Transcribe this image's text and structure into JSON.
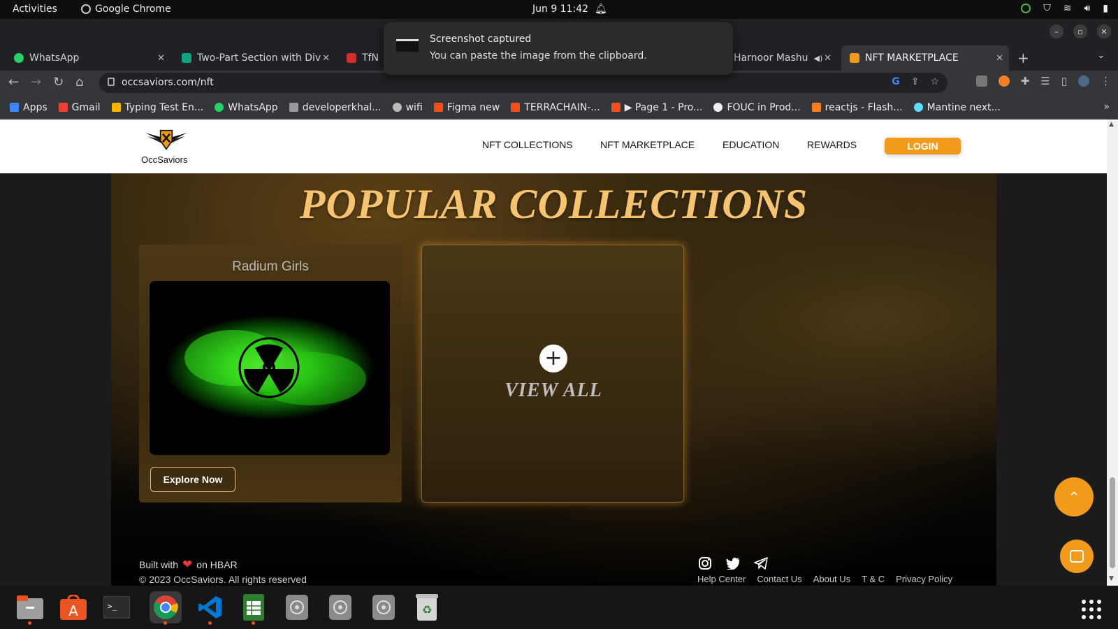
{
  "system": {
    "activities": "Activities",
    "app_name": "Google Chrome",
    "clock": "Jun 9  11:42"
  },
  "tabs": [
    {
      "label": "WhatsApp",
      "color": "#25d366"
    },
    {
      "label": "Two-Part Section with Div",
      "color": "#10a37f"
    },
    {
      "label": "TfN",
      "color": "#d32f2f"
    },
    {
      "label": "Harnoor Mashu",
      "color": "#888888"
    },
    {
      "label": "NFT MARKETPLACE",
      "color": "#f29a1c"
    }
  ],
  "toast": {
    "title": "Screenshot captured",
    "message": "You can paste the image from the clipboard."
  },
  "address_bar": {
    "url": "occsaviors.com/nft"
  },
  "bookmarks": [
    {
      "label": "Apps",
      "color": "#4285f4"
    },
    {
      "label": "Gmail",
      "color": "#ea4335"
    },
    {
      "label": "Typing Test En...",
      "color": "#f4b400"
    },
    {
      "label": "WhatsApp",
      "color": "#25d366"
    },
    {
      "label": "developerkhal...",
      "color": "#999999"
    },
    {
      "label": "wifi",
      "color": "#bbbbbb"
    },
    {
      "label": "Figma new",
      "color": "#f24e1e"
    },
    {
      "label": "TERRACHAIN-...",
      "color": "#f24e1e"
    },
    {
      "label": "▶ Page 1 - Pro...",
      "color": "#f24e1e"
    },
    {
      "label": "FOUC in Prod...",
      "color": "#eeeeee"
    },
    {
      "label": "reactjs - Flash...",
      "color": "#f48024"
    },
    {
      "label": "Mantine next...",
      "color": "#61dafb"
    }
  ],
  "site": {
    "logo_text": "OccSaviors",
    "nav": [
      "NFT COLLECTIONS",
      "NFT MARKETPLACE",
      "EDUCATION",
      "REWARDS"
    ],
    "login_label": "LOGIN",
    "accent": "#f29a1c",
    "hero_title": "POPULAR COLLECTIONS",
    "collection": {
      "name": "Radium Girls",
      "button": "Explore Now"
    },
    "view_all": "VIEW ALL",
    "footer": {
      "built_with": "Built with",
      "on_hbar": "on HBAR",
      "copyright": "© 2023 OccSaviors. All rights reserved",
      "links": [
        "Help Center",
        "Contact Us",
        "About Us",
        "T & C",
        "Privacy Policy"
      ],
      "social_icons": [
        "instagram-icon",
        "twitter-icon",
        "telegram-icon"
      ]
    }
  },
  "dock": {
    "apps": [
      "files",
      "app-store",
      "terminal",
      "chrome",
      "vscode",
      "spreadsheet",
      "disc",
      "disc",
      "disc",
      "trash"
    ]
  }
}
